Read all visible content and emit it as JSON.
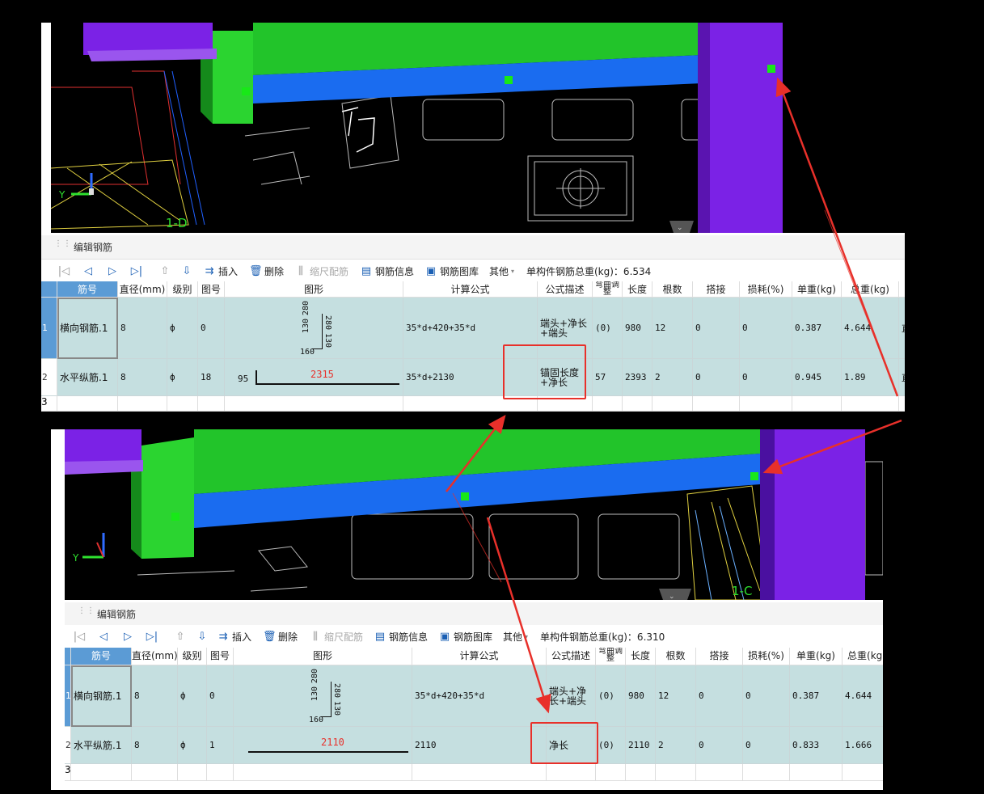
{
  "panel_title": "编辑钢筋",
  "toolbar": {
    "insert": "插入",
    "delete": "删除",
    "scale": "缩尺配筋",
    "info": "钢筋信息",
    "library": "钢筋图库",
    "other": "其他"
  },
  "columns": [
    "筋号",
    "直径(mm)",
    "级别",
    "图号",
    "图形",
    "计算公式",
    "公式描述",
    "弯曲调整",
    "长度",
    "根数",
    "搭接",
    "损耗(%)",
    "单重(kg)",
    "总重(kg)"
  ],
  "top": {
    "axis_label": "1-D",
    "total_weight": "单构件钢筋总重(kg)：6.534",
    "rows": [
      {
        "idx": "1",
        "name": "横向钢筋.1",
        "dia": "8",
        "grade": "ф",
        "fig": "0",
        "shape": {
          "a": "280",
          "b": "130",
          "c": "280",
          "d": "130",
          "bottom": "160"
        },
        "formula": "35*d+420+35*d",
        "desc": "端头+净长+端头",
        "bend": "(0)",
        "len": "980",
        "count": "12",
        "lap": "0",
        "loss": "0",
        "unit": "0.387",
        "total": "4.644",
        "extra": "直"
      },
      {
        "idx": "2",
        "name": "水平纵筋.1",
        "dia": "8",
        "grade": "ф",
        "fig": "18",
        "shape": {
          "left": "95",
          "main": "2315"
        },
        "formula": "35*d+2130",
        "desc": "锚固长度+净长",
        "bend": "57",
        "len": "2393",
        "count": "2",
        "lap": "0",
        "loss": "0",
        "unit": "0.945",
        "total": "1.89",
        "extra": "直"
      },
      {
        "idx": "3"
      }
    ]
  },
  "bottom": {
    "axis_label": "1-C",
    "total_weight": "单构件钢筋总重(kg)：6.310",
    "rows": [
      {
        "idx": "1",
        "name": "横向钢筋.1",
        "dia": "8",
        "grade": "ф",
        "fig": "0",
        "shape": {
          "a": "280",
          "b": "130",
          "c": "280",
          "d": "130",
          "bottom": "160"
        },
        "formula": "35*d+420+35*d",
        "desc": "端头+净长+端头",
        "bend": "(0)",
        "len": "980",
        "count": "12",
        "lap": "0",
        "loss": "0",
        "unit": "0.387",
        "total": "4.644"
      },
      {
        "idx": "2",
        "name": "水平纵筋.1",
        "dia": "8",
        "grade": "ф",
        "fig": "1",
        "shape": {
          "main": "2110"
        },
        "formula": "2110",
        "desc": "净长",
        "bend": "(0)",
        "len": "2110",
        "count": "2",
        "lap": "0",
        "loss": "0",
        "unit": "0.833",
        "total": "1.666"
      },
      {
        "idx": "3"
      }
    ]
  },
  "colors": {
    "green": "#22c42a",
    "blue": "#1a6cf0",
    "purple": "#7b22e6",
    "highlight": "#e8302a",
    "header": "#5b9bd5",
    "row": "#c5dfe0"
  },
  "axis_letters": {
    "y": "Y",
    "x": "X",
    "z": "Z"
  }
}
